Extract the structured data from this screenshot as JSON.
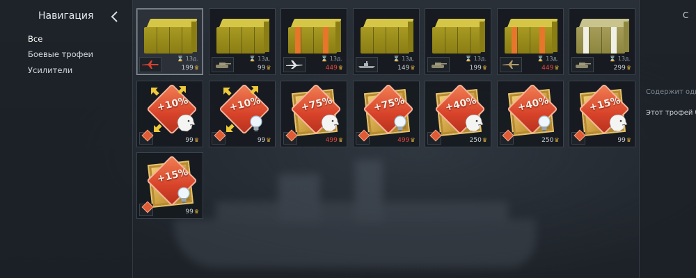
{
  "nav": {
    "title": "Навигация",
    "items": [
      "Все",
      "Боевые трофеи",
      "Усилители"
    ]
  },
  "crates": [
    {
      "vehicle": "plane-red",
      "duration": "13д.",
      "price": "199",
      "sale": false,
      "stripe": "none"
    },
    {
      "vehicle": "tank",
      "duration": "13д.",
      "price": "99",
      "sale": false,
      "stripe": "none"
    },
    {
      "vehicle": "jet-white",
      "duration": "13д.",
      "price": "449",
      "sale": true,
      "stripe": "orange"
    },
    {
      "vehicle": "ship",
      "duration": "13д.",
      "price": "149",
      "sale": false,
      "stripe": "none"
    },
    {
      "vehicle": "tank",
      "duration": "13д.",
      "price": "199",
      "sale": false,
      "stripe": "none"
    },
    {
      "vehicle": "plane-camo",
      "duration": "13д.",
      "price": "449",
      "sale": true,
      "stripe": "orange"
    },
    {
      "vehicle": "tank",
      "duration": "13д.",
      "price": "299",
      "sale": false,
      "stripe": "white"
    }
  ],
  "boosters": [
    {
      "percent": "+10%",
      "kind": "lion",
      "frame": false,
      "price": "99",
      "sale": false
    },
    {
      "percent": "+10%",
      "kind": "bulb",
      "frame": false,
      "price": "99",
      "sale": false
    },
    {
      "percent": "+75%",
      "kind": "lion",
      "frame": true,
      "price": "499",
      "sale": true
    },
    {
      "percent": "+75%",
      "kind": "bulb",
      "frame": true,
      "price": "499",
      "sale": true
    },
    {
      "percent": "+40%",
      "kind": "lion",
      "frame": true,
      "price": "250",
      "sale": false
    },
    {
      "percent": "+40%",
      "kind": "bulb",
      "frame": true,
      "price": "250",
      "sale": false
    },
    {
      "percent": "+15%",
      "kind": "lion",
      "frame": true,
      "price": "99",
      "sale": false
    },
    {
      "percent": "+15%",
      "kind": "bulb",
      "frame": true,
      "price": "99",
      "sale": false
    }
  ],
  "info": {
    "title": "С",
    "contains": "Содержит оди",
    "description": "Этот трофей б"
  },
  "colors": {
    "sale": "#e8463c",
    "eagle": "#e2b13c"
  }
}
